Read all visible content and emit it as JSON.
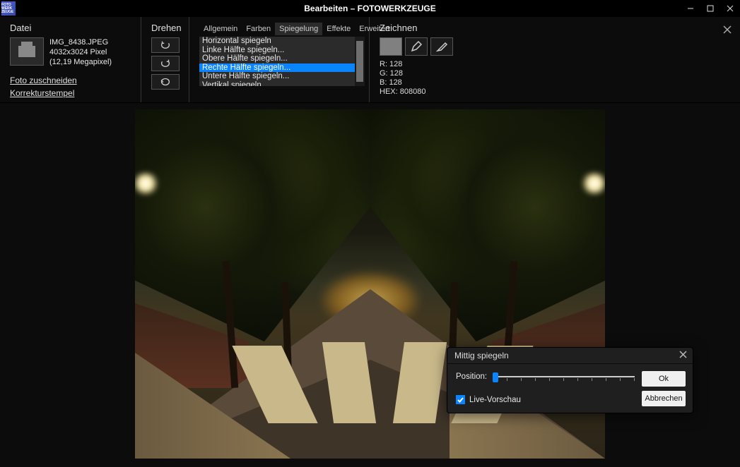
{
  "window": {
    "title": "Bearbeiten – FOTOWERKZEUGE",
    "app_icon_text": "FOTO\nWERK\nZEUGE"
  },
  "sections": {
    "datei": {
      "heading": "Datei",
      "filename": "IMG_8438.JPEG",
      "dimensions": "4032x3024 Pixel",
      "megapixel": "(12,19 Megapixel)",
      "link_crop": "Foto zuschneiden",
      "link_stamp": "Korrekturstempel"
    },
    "drehen": {
      "heading": "Drehen"
    },
    "tabs": {
      "items": [
        "Allgemein",
        "Farben",
        "Spiegelung",
        "Effekte",
        "Erweitert"
      ],
      "active_index": 2
    },
    "list": {
      "items": [
        "Horizontal spiegeln",
        "Linke Hälfte spiegeln...",
        "Obere Hälfte spiegeln...",
        "Rechte Hälfte spiegeln...",
        "Untere Hälfte spiegeln...",
        "Vertikal spiegeln"
      ],
      "selected_index": 3
    },
    "zeichnen": {
      "heading": "Zeichnen",
      "r": "R: 128",
      "g": "G: 128",
      "b": "B: 128",
      "hex": "HEX: 808080",
      "swatch_color": "#808080"
    }
  },
  "dialog": {
    "title": "Mittig spiegeln",
    "position_label": "Position:",
    "ok": "Ok",
    "cancel": "Abbrechen",
    "live_preview": "Live-Vorschau",
    "live_preview_checked": true
  }
}
